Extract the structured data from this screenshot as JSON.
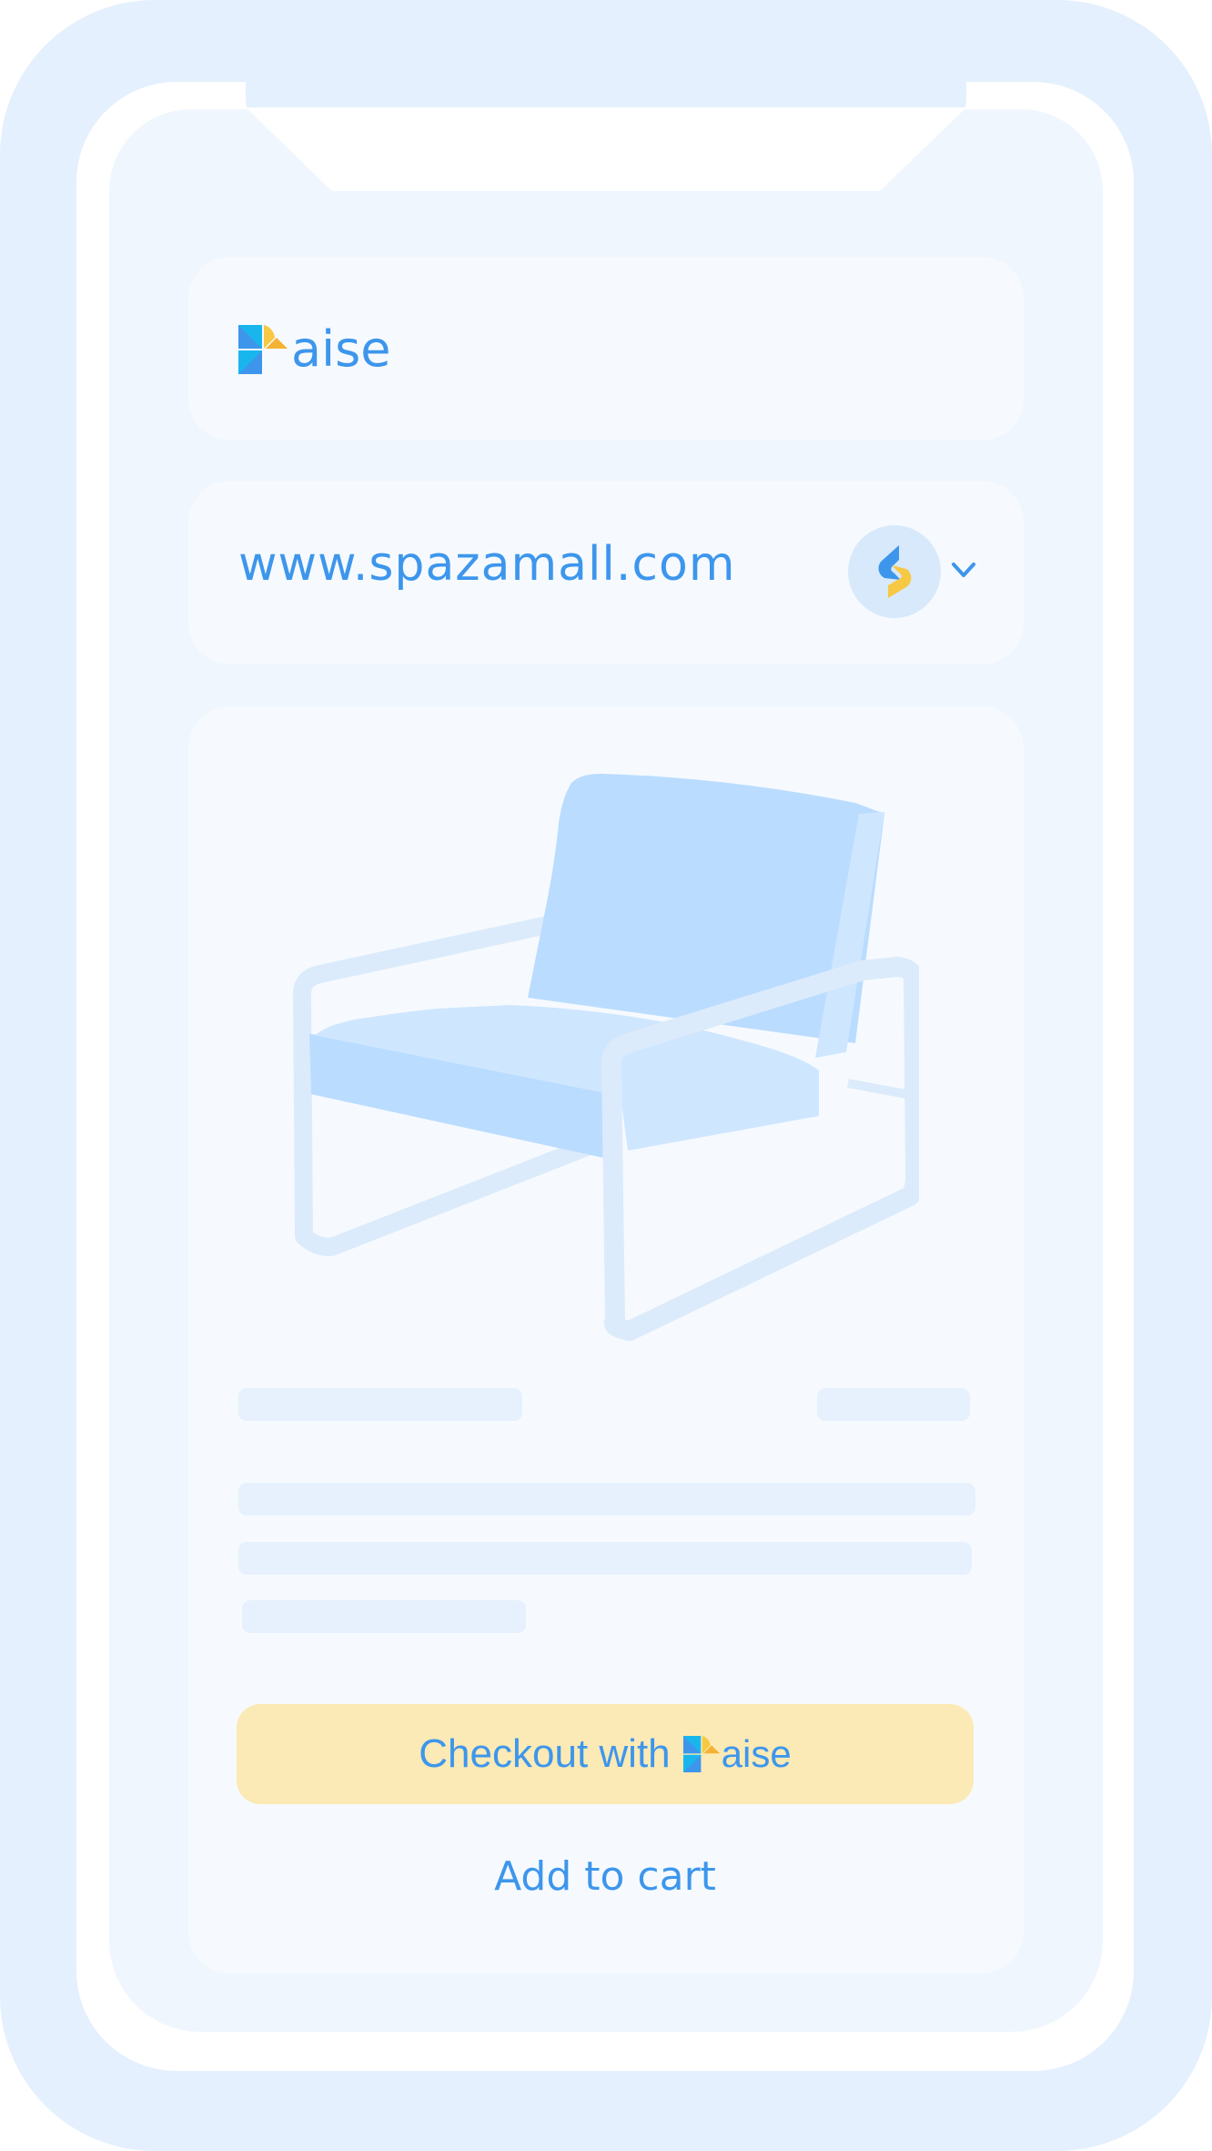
{
  "brand": {
    "logo_word": "aise",
    "colors": {
      "primary_blue": "#3d96ec",
      "cyan": "#19b6ee",
      "yellow": "#f7c843",
      "checkout_bg": "#fbeab5"
    }
  },
  "address_bar": {
    "url": "www.spazamall.com",
    "store_icon": "spazamall-logo-icon",
    "dropdown_icon": "chevron-down-icon"
  },
  "product": {
    "image": "armchair-illustration",
    "title_placeholder": "",
    "price_placeholder": "",
    "description_placeholder_lines": 3
  },
  "actions": {
    "checkout_label": "Checkout with",
    "checkout_brand": "aise",
    "add_to_cart_label": "Add to cart"
  }
}
